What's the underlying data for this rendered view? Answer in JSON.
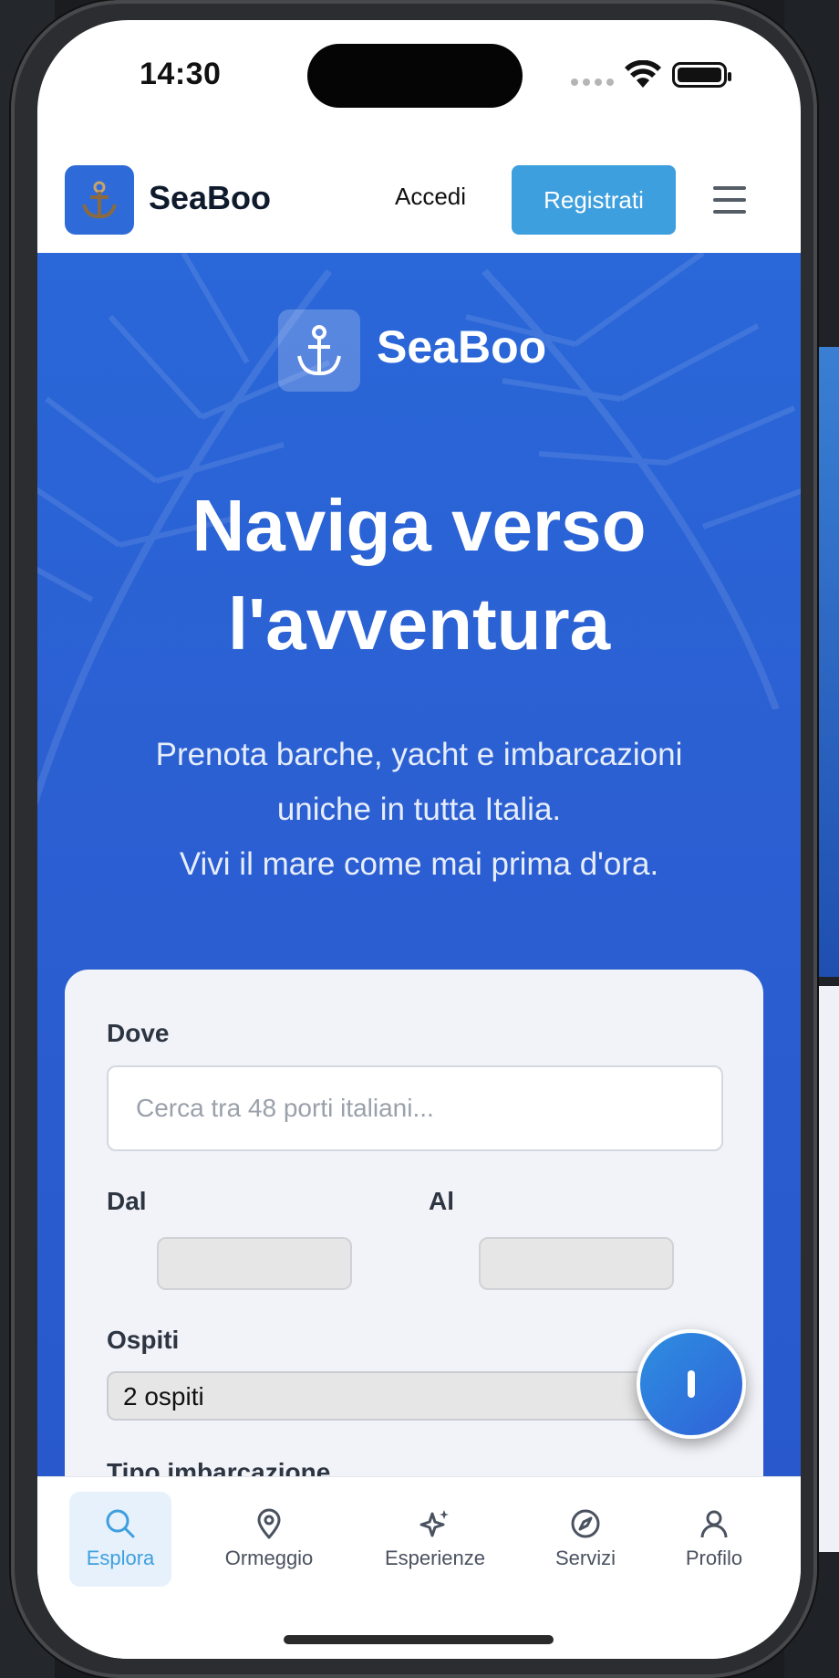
{
  "status_bar": {
    "time": "14:30"
  },
  "header": {
    "brand": "SeaBoo",
    "login_label": "Accedi",
    "register_label": "Registrati",
    "menu_icon": "hamburger-icon"
  },
  "hero": {
    "brand": "SeaBoo",
    "title_line1": "Naviga verso",
    "title_line2": "l'avventura",
    "subtitle_line1": "Prenota barche, yacht e imbarcazioni",
    "subtitle_line2": "uniche in tutta Italia.",
    "subtitle_line3": "Vivi il mare come mai prima d'ora."
  },
  "search": {
    "where_label": "Dove",
    "where_placeholder": "Cerca tra 48 porti italiani...",
    "from_label": "Dal",
    "to_label": "Al",
    "guests_label": "Ospiti",
    "guests_value": "2 ospiti",
    "boat_type_label": "Tipo imbarcazione"
  },
  "tabbar": {
    "items": [
      {
        "label": "Esplora",
        "icon": "search-icon",
        "active": true
      },
      {
        "label": "Ormeggio",
        "icon": "map-pin-icon",
        "active": false
      },
      {
        "label": "Esperienze",
        "icon": "sparkles-icon",
        "active": false
      },
      {
        "label": "Servizi",
        "icon": "compass-icon",
        "active": false
      },
      {
        "label": "Profilo",
        "icon": "user-icon",
        "active": false
      }
    ]
  },
  "colors": {
    "accent": "#3e9fde",
    "brand_blue": "#2f6bd8",
    "hero_blue": "#2a67d8",
    "card_bg": "#f1f3f8"
  }
}
